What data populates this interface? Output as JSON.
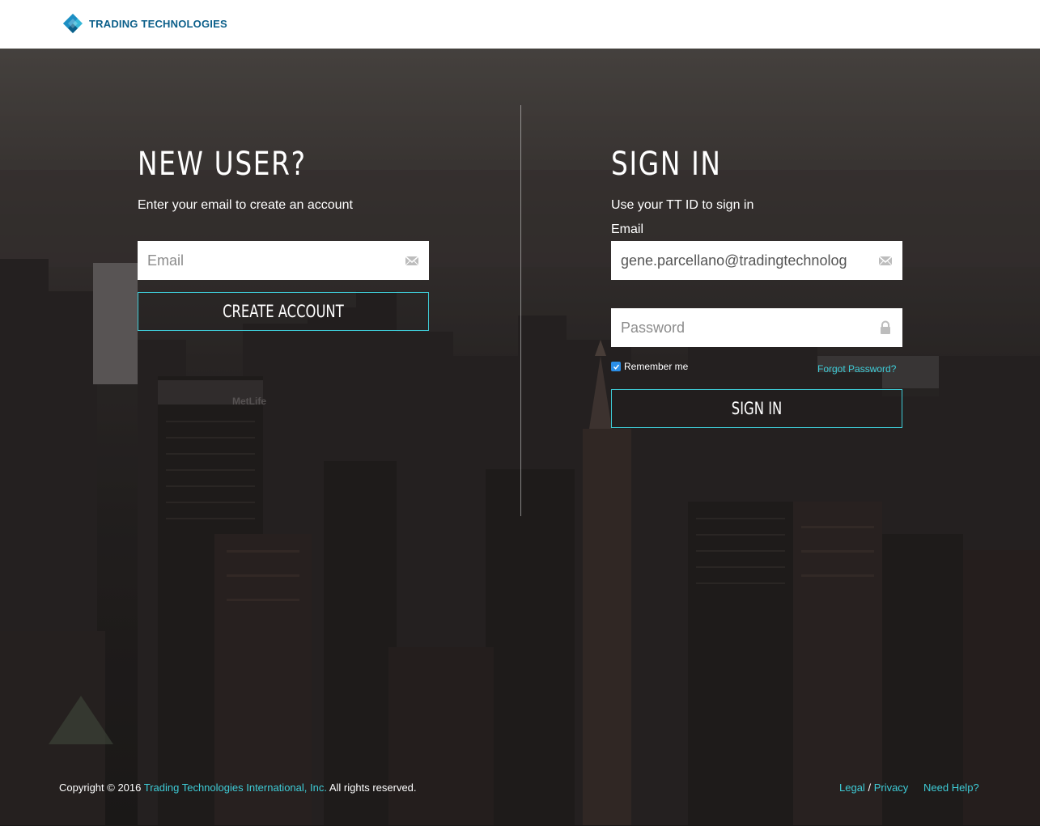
{
  "header": {
    "logo_text": "TRADING TECHNOLOGIES"
  },
  "new_user": {
    "title": "NEW USER?",
    "subtitle": "Enter your email to create an account",
    "email_placeholder": "Email",
    "create_button_label": "CREATE ACCOUNT"
  },
  "sign_in": {
    "title": "SIGN IN",
    "subtitle": "Use your TT ID to sign in",
    "email_label": "Email",
    "email_value": "gene.parcellano@tradingtechnolog",
    "password_placeholder": "Password",
    "remember_label": "Remember me",
    "remember_checked": true,
    "forgot_label": "Forgot Password?",
    "sign_in_button_label": "SIGN IN"
  },
  "footer": {
    "copyright_prefix": "Copyright © 2016",
    "company_link": "Trading Technologies International, Inc.",
    "rights": "All rights reserved.",
    "legal_label": "Legal",
    "separator": "/",
    "privacy_label": "Privacy",
    "help_label": "Need Help?"
  },
  "colors": {
    "accent": "#3ecbd6",
    "brand": "#0b5f8a",
    "checkbox": "#2a8ee8"
  },
  "icons": {
    "email": "envelope-icon",
    "password": "lock-icon",
    "logo": "trading-technologies-logo-icon"
  }
}
